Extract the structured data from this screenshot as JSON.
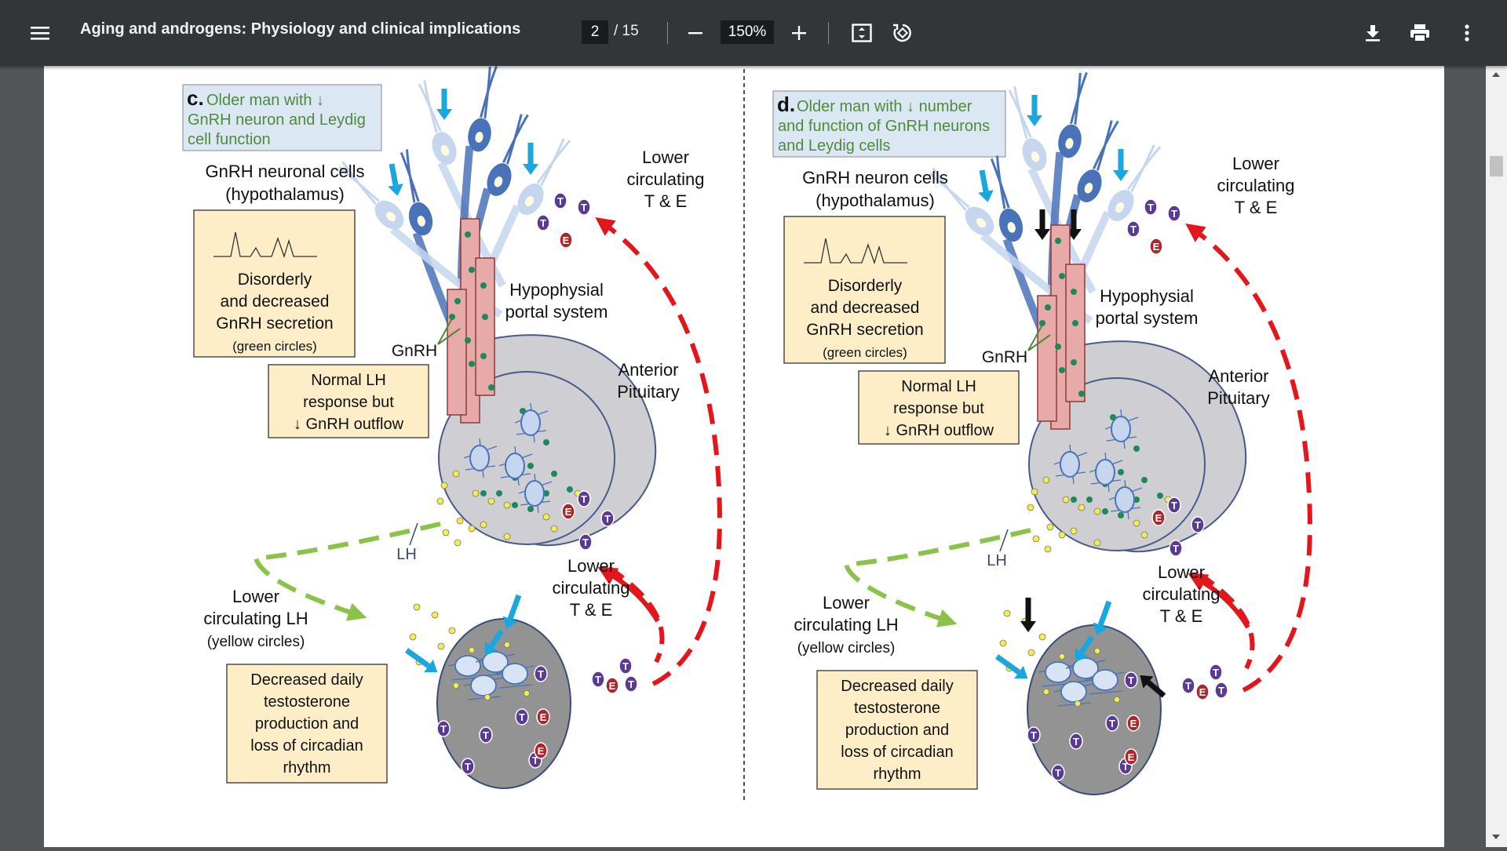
{
  "toolbar": {
    "title": "Aging and androgens: Physiology and clinical implications",
    "page_current": "2",
    "page_total": "/ 15",
    "zoom": "150%",
    "icons": [
      "menu-icon",
      "zoom-out-icon",
      "zoom-in-icon",
      "fit-page-icon",
      "rotate-icon",
      "download-icon",
      "print-icon",
      "more-icon"
    ]
  },
  "figure": {
    "panel_c": {
      "letter": "c.",
      "heading": [
        "Older man with ↓",
        "GnRH neuron and Leydig",
        "cell function"
      ],
      "neuron_label": [
        "GnRH neuronal cells",
        "(hypothalamus)"
      ],
      "secretion": [
        "Disorderly",
        "and decreased",
        "GnRH secretion",
        "(green circles)"
      ],
      "lh_response": [
        "Normal LH",
        "response but",
        "↓ GnRH outflow"
      ],
      "gnrh": "GnRH",
      "portal": [
        "Hypophysial",
        "portal system"
      ],
      "pituitary": [
        "Anterior",
        "Pituitary"
      ],
      "lower_te_top": [
        "Lower",
        "circulating",
        "T & E"
      ],
      "lower_te_mid": [
        "Lower",
        "circulating",
        "T & E"
      ],
      "lh": "LH",
      "lower_lh": [
        "Lower",
        "circulating LH",
        "(yellow circles)"
      ],
      "testis": [
        "Decreased daily",
        "testosterone",
        "production and",
        "loss of circadian",
        "rhythm"
      ]
    },
    "panel_d": {
      "letter": "d.",
      "heading": [
        "Older man with ↓ number",
        "and function of GnRH neurons",
        "and Leydig cells"
      ],
      "neuron_label": [
        "GnRH neuron cells",
        "(hypothalamus)"
      ],
      "secretion": [
        "Disorderly",
        "and decreased",
        "GnRH secretion",
        "(green circles)"
      ],
      "lh_response": [
        "Normal LH",
        "response but",
        "↓ GnRH outflow"
      ],
      "gnrh": "GnRH",
      "portal": [
        "Hypophysial",
        "portal system"
      ],
      "pituitary": [
        "Anterior",
        "Pituitary"
      ],
      "lower_te_top": [
        "Lower",
        "circulating",
        "T & E"
      ],
      "lower_te_mid": [
        "Lower",
        "circulating",
        "T & E"
      ],
      "lh": "LH",
      "lower_lh": [
        "Lower",
        "circulating LH",
        "(yellow circles)"
      ],
      "testis": [
        "Decreased daily",
        "testosterone",
        "production and",
        "loss of circadian",
        "rhythm"
      ]
    },
    "t_symbol": "T",
    "e_symbol": "E",
    "colors": {
      "heading_bg": "#dbe8f4",
      "heading_text": "#4f8a3b",
      "note_bg": "#fdeec8",
      "pituitary": "#cfcfd3",
      "testis": "#939393",
      "portal": "#e8a9a9",
      "neuron": "#4a72b8",
      "blue_arrow": "#1aa7e0",
      "red_arrow": "#e3161c",
      "green_arrow": "#8bc34a",
      "t_circle": "#5b3a96",
      "e_circle": "#b0252a",
      "gnrh_dot": "#1a8a5c",
      "lh_dot": "#f3ee4a"
    }
  }
}
